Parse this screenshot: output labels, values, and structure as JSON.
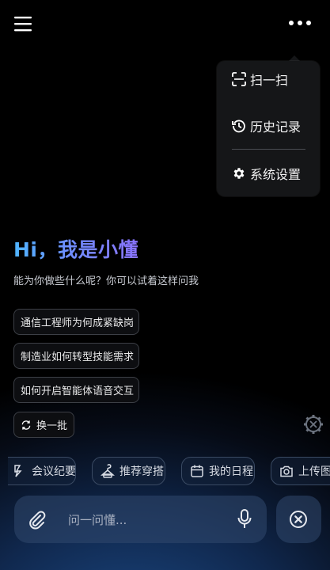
{
  "header": {
    "menu_icon": "hamburger-menu-icon",
    "more_icon": "more-horizontal-icon"
  },
  "dropdown": {
    "items": [
      {
        "label": "扫一扫",
        "icon": "scan-icon"
      },
      {
        "label": "历史记录",
        "icon": "history-icon"
      },
      {
        "label": "系统设置",
        "icon": "gear-icon"
      }
    ]
  },
  "greeting": {
    "title": "Hi，我是小懂",
    "subtitle": "能为你做些什么呢？你可以试着这样问我"
  },
  "suggestions": [
    "通信工程师为何成紧缺岗",
    "制造业如何转型技能需求",
    "如何开启智能体语音交互"
  ],
  "refresh_label": "换一批",
  "tools": [
    {
      "label": "会议纪要",
      "icon": "meeting-notes-icon"
    },
    {
      "label": "推荐穿搭",
      "icon": "outfit-icon"
    },
    {
      "label": "我的日程",
      "icon": "calendar-icon"
    },
    {
      "label": "上传图",
      "icon": "camera-icon"
    }
  ],
  "input": {
    "placeholder": "问一问懂..."
  },
  "colors": {
    "greeting_gradient_start": "#4fb4ff",
    "greeting_gradient_end": "#8a73ff",
    "dropdown_bg": "#151618"
  }
}
